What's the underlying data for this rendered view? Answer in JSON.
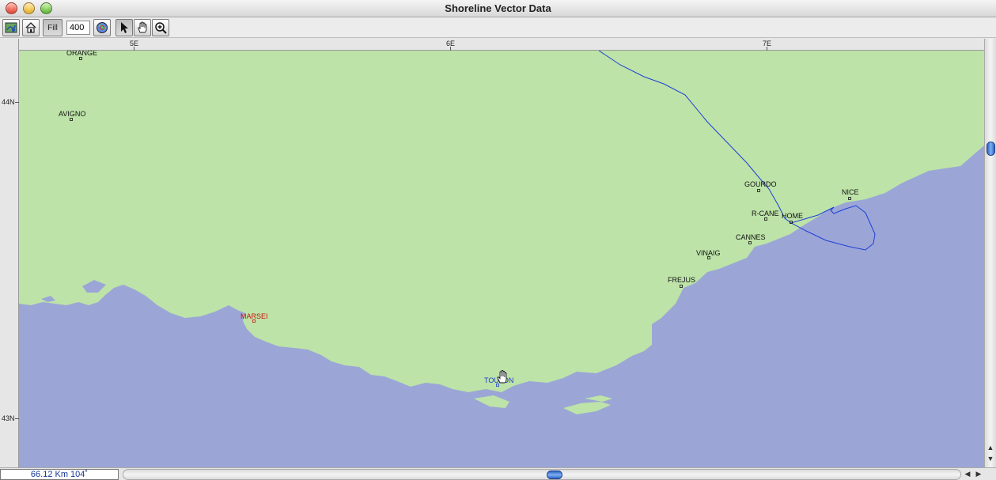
{
  "window": {
    "title": "Shoreline Vector Data"
  },
  "toolbar": {
    "fill_label": "Fill",
    "scale_value": "400",
    "tools": [
      {
        "name": "refresh-map-icon"
      },
      {
        "name": "home-icon"
      },
      {
        "name": "fill-toggle"
      },
      {
        "name": "globe-icon"
      },
      {
        "name": "arrow-pointer-icon"
      },
      {
        "name": "hand-pan-icon"
      },
      {
        "name": "zoom-in-icon"
      }
    ]
  },
  "rulers": {
    "longitude": [
      "5E",
      "6E",
      "7E"
    ],
    "latitude": [
      "44N",
      "43N"
    ]
  },
  "map": {
    "colors": {
      "land": "#bde3a8",
      "sea": "#9ba6d6",
      "track": "#1f3fd8",
      "city": "#111111",
      "highlight_city": "#cc1111",
      "selected_city": "#1a3ad0"
    },
    "cities": [
      {
        "name": "ORANGE",
        "style": "normal"
      },
      {
        "name": "AVIGNO",
        "style": "normal"
      },
      {
        "name": "MARSEI",
        "style": "highlight"
      },
      {
        "name": "TOULON",
        "style": "selected"
      },
      {
        "name": "FREJUS",
        "style": "normal"
      },
      {
        "name": "VINAIG",
        "style": "normal"
      },
      {
        "name": "CANNES",
        "style": "normal"
      },
      {
        "name": "R-CANE",
        "style": "normal"
      },
      {
        "name": "HOME",
        "style": "normal"
      },
      {
        "name": "GOURDO",
        "style": "normal"
      },
      {
        "name": "NICE",
        "style": "normal"
      }
    ]
  },
  "status": {
    "readout": "66.12 Km 104˚"
  }
}
